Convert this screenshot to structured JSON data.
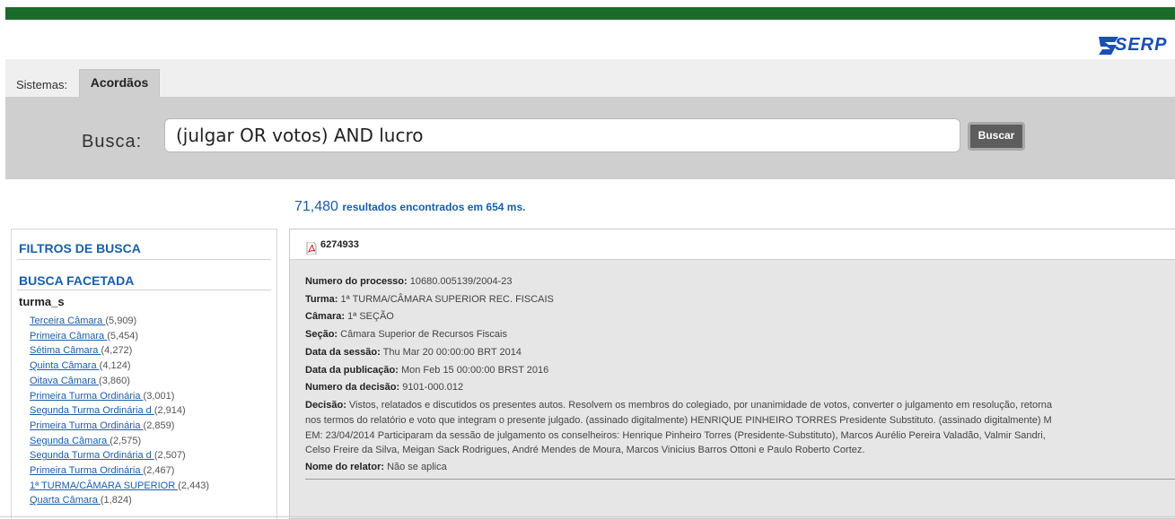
{
  "logo": {
    "text": "SERP",
    "icon": "serpro-s-logo-icon"
  },
  "nav": {
    "sistemas_label": "Sistemas:",
    "active_tab": "Acordãos"
  },
  "search": {
    "label": "Busca:",
    "value": "(julgar OR votos) AND lucro",
    "button_label": "Buscar"
  },
  "results": {
    "count": "71,480",
    "summary": "resultados encontrados em 654 ms."
  },
  "sidebar": {
    "filters_title": "FILTROS DE BUSCA",
    "faceted_title": "BUSCA FACETADA",
    "facet_field": "turma_s",
    "facets": [
      {
        "label": "Terceira Câmara ",
        "count": "(5,909)"
      },
      {
        "label": "Primeira Câmara ",
        "count": "(5,454)"
      },
      {
        "label": "Sétima Câmara ",
        "count": "(4,272)"
      },
      {
        "label": "Quinta Câmara ",
        "count": "(4,124)"
      },
      {
        "label": "Oitava Câmara ",
        "count": "(3,860)"
      },
      {
        "label": "Primeira Turma Ordinária ",
        "count": "(3,001)"
      },
      {
        "label": "Segunda Turma Ordinária d ",
        "count": "(2,914)"
      },
      {
        "label": "Primeira Turma Ordinária ",
        "count": "(2,859)"
      },
      {
        "label": "Segunda Câmara ",
        "count": "(2,575)"
      },
      {
        "label": "Segunda Turma Ordinária d ",
        "count": "(2,507)"
      },
      {
        "label": "Primeira Turma Ordinária ",
        "count": "(2,467)"
      },
      {
        "label": "1ª TURMA/CÂMARA SUPERIOR ",
        "count": "(2,443)"
      },
      {
        "label": "Quarta Câmara ",
        "count": "(1,824)"
      }
    ]
  },
  "result": {
    "doc_id": "6274933",
    "pdf_icon": "pdf-file-icon",
    "fields": [
      {
        "label": "Numero do processo:",
        "value": " 10680.005139/2004-23"
      },
      {
        "label": "Turma:",
        "value": " 1ª TURMA/CÂMARA SUPERIOR REC. FISCAIS"
      },
      {
        "label": "Câmara:",
        "value": " 1ª SEÇÃO"
      },
      {
        "label": "Seção:",
        "value": " Câmara Superior de Recursos Fiscais"
      },
      {
        "label": "Data da sessão:",
        "value": " Thu Mar 20 00:00:00 BRT 2014"
      },
      {
        "label": "Data da publicação:",
        "value": " Mon Feb 15 00:00:00 BRST 2016"
      },
      {
        "label": "Numero da decisão:",
        "value": " 9101-000.012"
      }
    ],
    "decisao_label": "Decisão:",
    "decisao_lines": [
      " Vistos, relatados e discutidos os presentes autos. Resolvem os membros do colegiado, por unanimidade de votos, converter o julgamento em resolução, retorna",
      "nos termos do relatório e voto que integram o presente julgado. (assinado digitalmente) HENRIQUE PINHEIRO TORRES  Presidente Substituto. (assinado digitalmente) M",
      "EM: 23/04/2014 Participaram da sessão de julgamento os conselheiros: Henrique Pinheiro Torres (Presidente-Substituto), Marcos Aurélio Pereira Valadão, Valmir Sandri, ",
      "Celso Freire da Silva, Meigan Sack Rodrigues, André Mendes de Moura, Marcos Vinicius Barros Ottoni e Paulo Roberto Cortez."
    ],
    "relator_label": "Nome do relator:",
    "relator_value": " Não se aplica"
  }
}
